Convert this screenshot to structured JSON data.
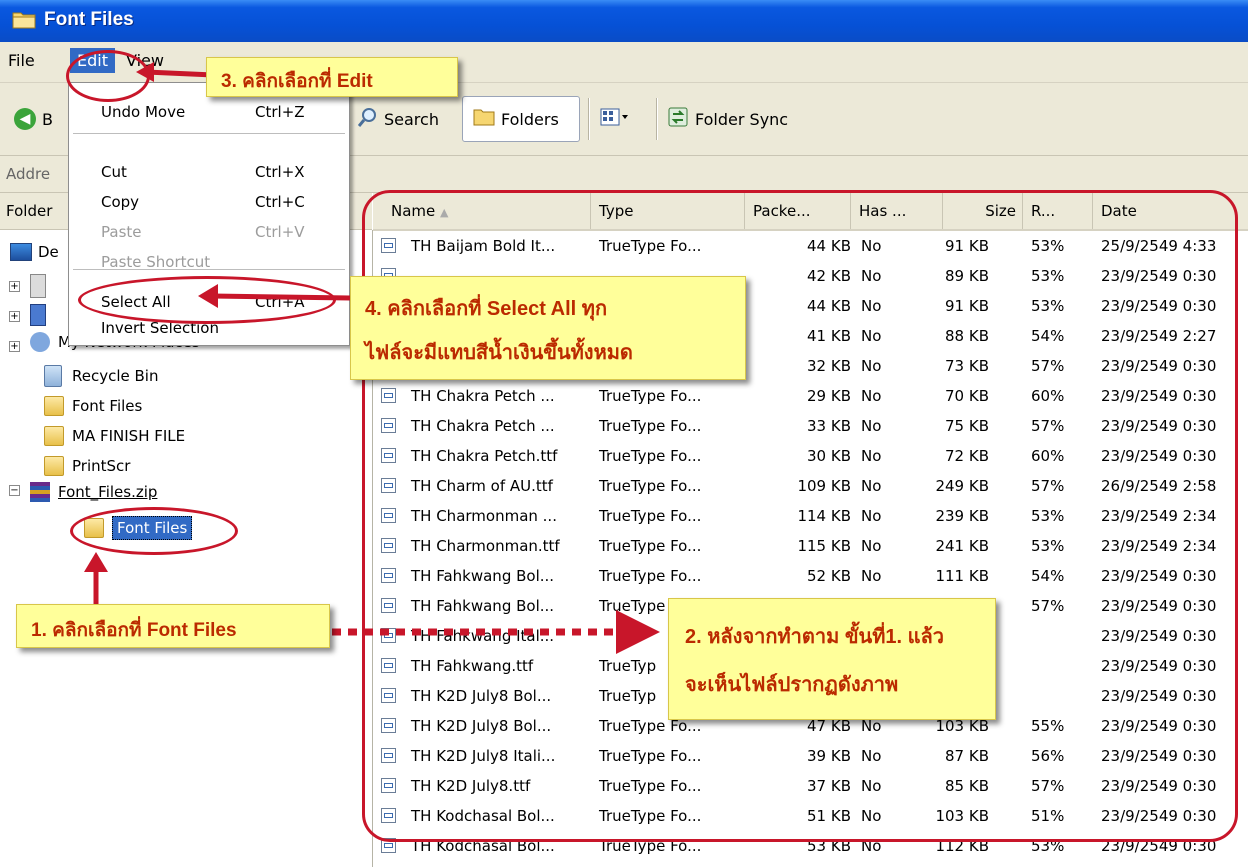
{
  "window": {
    "title": "Font Files"
  },
  "menubar": {
    "file": "File",
    "edit": "Edit",
    "view": "View"
  },
  "toolbar": {
    "back": "B",
    "search": "Search",
    "folders": "Folders",
    "folder_sync": "Folder Sync"
  },
  "address": {
    "label": "Addre"
  },
  "folders_pane": {
    "header": "Folder",
    "items": [
      {
        "label": "De",
        "icon": "desktop-icon"
      },
      {
        "label": "My Network Places",
        "icon": "network-icon"
      },
      {
        "label": "Recycle Bin",
        "icon": "recycle-bin-icon"
      },
      {
        "label": "Font Files",
        "icon": "folder-icon"
      },
      {
        "label": "MA FINISH FILE",
        "icon": "folder-icon"
      },
      {
        "label": "PrintScr",
        "icon": "folder-icon"
      },
      {
        "label": "Font_Files.zip",
        "icon": "zip-archive-icon"
      },
      {
        "label": "Font Files",
        "icon": "folder-icon",
        "selected": true
      }
    ]
  },
  "edit_menu": {
    "items": [
      {
        "label": "Undo Move",
        "shortcut": "Ctrl+Z",
        "disabled": false
      },
      {
        "label": "Cut",
        "shortcut": "Ctrl+X",
        "disabled": false
      },
      {
        "label": "Copy",
        "shortcut": "Ctrl+C",
        "disabled": false
      },
      {
        "label": "Paste",
        "shortcut": "Ctrl+V",
        "disabled": true
      },
      {
        "label": "Paste Shortcut",
        "shortcut": "",
        "disabled": true
      },
      {
        "label": "Select All",
        "shortcut": "Ctrl+A",
        "disabled": false
      },
      {
        "label": "Invert Selection",
        "shortcut": "",
        "disabled": false
      }
    ]
  },
  "list": {
    "columns": [
      "Name",
      "Type",
      "Packe...",
      "Has ...",
      "Size",
      "R...",
      "Date"
    ],
    "rows": [
      [
        "TH Baijam Bold It...",
        "TrueType Fo...",
        "44 KB",
        "No",
        "91 KB",
        "53%",
        "25/9/2549 4:33"
      ],
      [
        "",
        "",
        "42 KB",
        "No",
        "89 KB",
        "53%",
        "23/9/2549 0:30"
      ],
      [
        "",
        "",
        "44 KB",
        "No",
        "91 KB",
        "53%",
        "23/9/2549 0:30"
      ],
      [
        "",
        "",
        "41 KB",
        "No",
        "88 KB",
        "54%",
        "23/9/2549 2:27"
      ],
      [
        "",
        "",
        "32 KB",
        "No",
        "73 KB",
        "57%",
        "23/9/2549 0:30"
      ],
      [
        "TH Chakra Petch ...",
        "TrueType Fo...",
        "29 KB",
        "No",
        "70 KB",
        "60%",
        "23/9/2549 0:30"
      ],
      [
        "TH Chakra Petch ...",
        "TrueType Fo...",
        "33 KB",
        "No",
        "75 KB",
        "57%",
        "23/9/2549 0:30"
      ],
      [
        "TH Chakra Petch.ttf",
        "TrueType Fo...",
        "30 KB",
        "No",
        "72 KB",
        "60%",
        "23/9/2549 0:30"
      ],
      [
        "TH Charm of AU.ttf",
        "TrueType Fo...",
        "109 KB",
        "No",
        "249 KB",
        "57%",
        "26/9/2549 2:58"
      ],
      [
        "TH Charmonman ...",
        "TrueType Fo...",
        "114 KB",
        "No",
        "239 KB",
        "53%",
        "23/9/2549 2:34"
      ],
      [
        "TH Charmonman.ttf",
        "TrueType Fo...",
        "115 KB",
        "No",
        "241 KB",
        "53%",
        "23/9/2549 2:34"
      ],
      [
        "TH Fahkwang Bol...",
        "TrueType Fo...",
        "52 KB",
        "No",
        "111 KB",
        "54%",
        "23/9/2549 0:30"
      ],
      [
        "TH Fahkwang Bol...",
        "TrueType",
        "",
        "",
        "",
        "57%",
        "23/9/2549 0:30"
      ],
      [
        "TH Fahkwang Ital...",
        "",
        "",
        "",
        "",
        "",
        "23/9/2549 0:30"
      ],
      [
        "TH Fahkwang.ttf",
        "TrueTyp",
        "",
        "",
        "",
        "",
        "23/9/2549 0:30"
      ],
      [
        "TH K2D July8 Bol...",
        "TrueTyp",
        "",
        "",
        "",
        "",
        "23/9/2549 0:30"
      ],
      [
        "TH K2D July8 Bol...",
        "TrueType Fo...",
        "47 KB",
        "No",
        "103 KB",
        "55%",
        "23/9/2549 0:30"
      ],
      [
        "TH K2D July8 Itali...",
        "TrueType Fo...",
        "39 KB",
        "No",
        "87 KB",
        "56%",
        "23/9/2549 0:30"
      ],
      [
        "TH K2D July8.ttf",
        "TrueType Fo...",
        "37 KB",
        "No",
        "85 KB",
        "57%",
        "23/9/2549 0:30"
      ],
      [
        "TH Kodchasal Bol...",
        "TrueType Fo...",
        "51 KB",
        "No",
        "103 KB",
        "51%",
        "23/9/2549 0:30"
      ],
      [
        "TH Kodchasal Bol...",
        "TrueType Fo...",
        "53 KB",
        "No",
        "112 KB",
        "53%",
        "23/9/2549 0:30"
      ]
    ]
  },
  "callouts": {
    "step1": "1. คลิกเลือกที่ Font Files",
    "step2_line1": "2. หลังจากทำตาม ขั้นที่1. แล้ว",
    "step2_line2": "จะเห็นไฟล์ปรากฏดังภาพ",
    "step3": "3. คลิกเลือกที่ Edit",
    "step4_line1": "4. คลิกเลือกที่ Select All ทุก",
    "step4_line2": "ไฟล์จะมีแทบสีน้ำเงินขึ้นทั้งหมด"
  },
  "colors": {
    "title_blue": "#0651d6",
    "chrome": "#ece9d8",
    "callout_yellow": "#ffff9a",
    "callout_text": "#bb2a00",
    "annotation_red": "#c8162a"
  }
}
